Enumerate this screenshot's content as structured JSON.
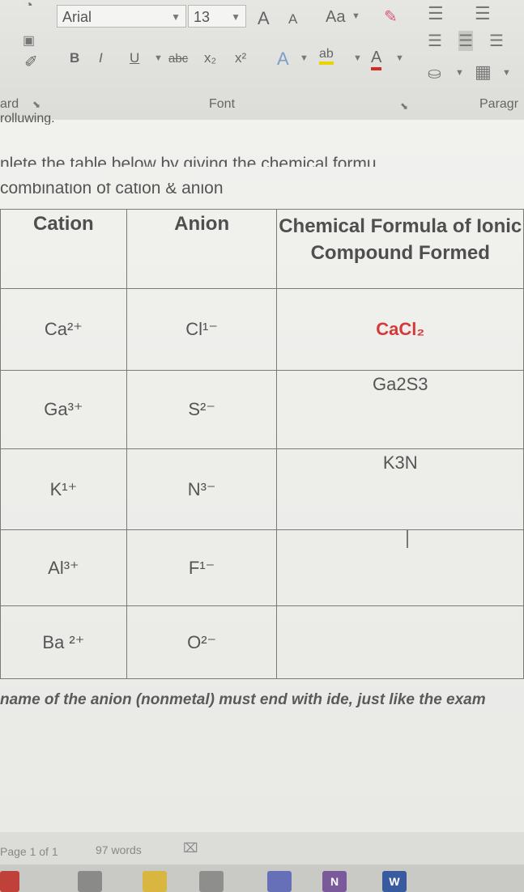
{
  "ribbon": {
    "font_name": "Arial",
    "font_size": "13",
    "grow_font": "A",
    "shrink_font": "A",
    "change_case": "Aa",
    "bold": "B",
    "italic": "I",
    "underline": "U",
    "strikethrough": "abc",
    "subscript": "x₂",
    "superscript": "x²",
    "text_effects": "A",
    "highlight": "ab",
    "font_color": "A",
    "clipboard_label": "ard",
    "font_group_label": "Font",
    "paragraph_group_label": "Paragr"
  },
  "document": {
    "fragment_top": "rolluwing.",
    "instruction_partial": "nlete the table below by giving the chemical formu",
    "header_partial": "combination of cation & anion",
    "table": {
      "headers": [
        "Cation",
        "Anion",
        "Chemical Formula of Ionic Compound Formed"
      ],
      "rows": [
        {
          "cation": "Ca²⁺",
          "anion": "Cl¹⁻",
          "formula": "CaCl₂"
        },
        {
          "cation": "Ga³⁺",
          "anion": "S²⁻",
          "formula": "Ga2S3"
        },
        {
          "cation": "K¹⁺",
          "anion": "N³⁻",
          "formula": "K3N"
        },
        {
          "cation": "Al³⁺",
          "anion": "F¹⁻",
          "formula": ""
        },
        {
          "cation": "Ba ²⁺",
          "anion": "O²⁻",
          "formula": ""
        }
      ]
    },
    "note": "name of the anion (nonmetal) must end with ide, just like the exam"
  },
  "status": {
    "page": "Page 1 of 1",
    "words": "97 words"
  },
  "colors": {
    "example_answer": "#d43a3a",
    "font_color_bar": "#d42a2a",
    "highlight_bar": "#e8d400"
  }
}
